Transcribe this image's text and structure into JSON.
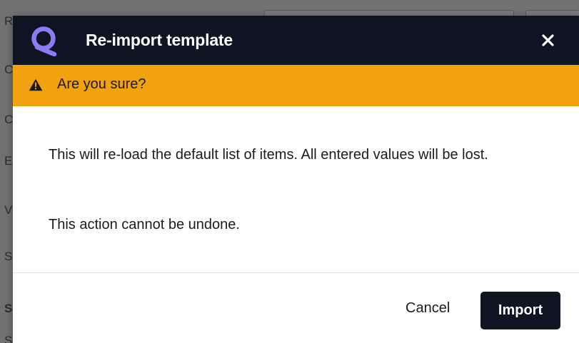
{
  "background": {
    "letters": [
      "R",
      "C",
      "C",
      "E",
      "V",
      "S",
      "S",
      "S"
    ]
  },
  "dialog": {
    "title": "Re-import template",
    "close_symbol": "✕",
    "logo_icon": "app-logo-icon",
    "warning": {
      "icon": "warning-triangle-icon",
      "text": "Are you sure?",
      "color": "#f0a30f"
    },
    "body": {
      "paragraph1": "This will re-load the default list of items. All entered values will be lost.",
      "paragraph2": "This action cannot be undone."
    },
    "footer": {
      "cancel_label": "Cancel",
      "import_label": "Import"
    },
    "colors": {
      "header_bg": "#0f1423",
      "accent": "#8b7cf6",
      "primary_button": "#0f1423"
    }
  }
}
